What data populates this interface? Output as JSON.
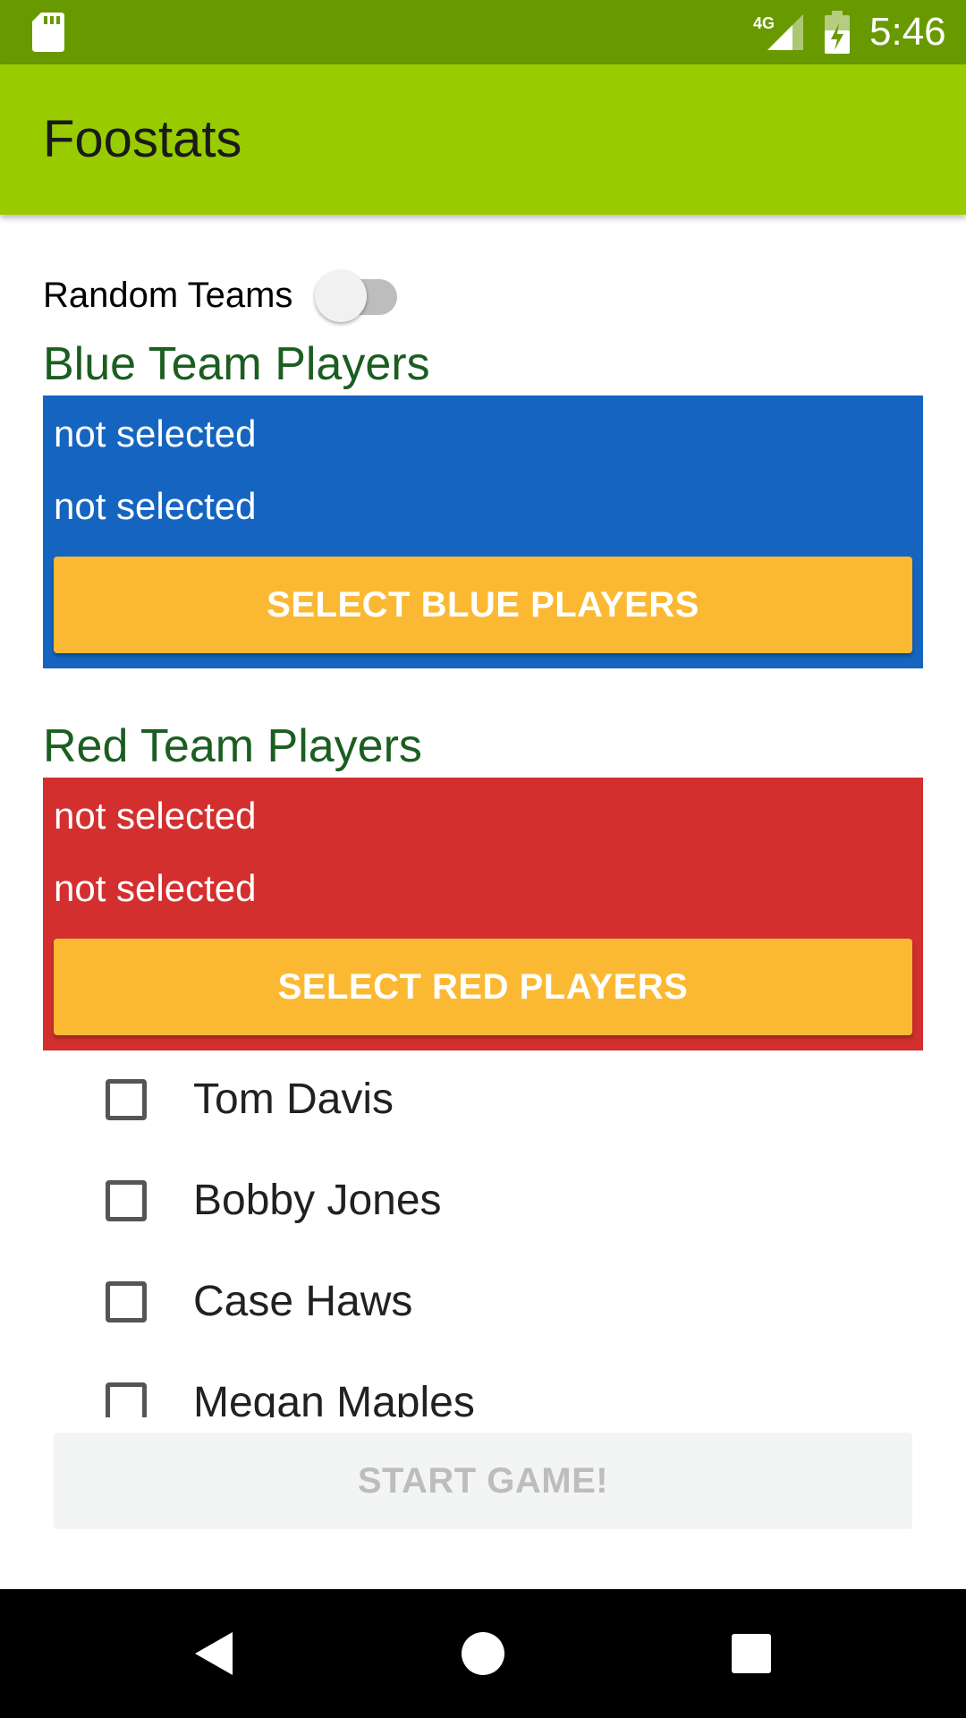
{
  "status_bar": {
    "time": "5:46",
    "network": "4G",
    "icons": [
      "sd-card-icon",
      "signal-icon",
      "battery-icon"
    ],
    "background": "#689a00"
  },
  "app_bar": {
    "title": "Foostats",
    "background": "#99cc00"
  },
  "random_teams": {
    "label": "Random Teams",
    "enabled": false
  },
  "blue_team": {
    "heading": "Blue Team Players",
    "color": "#1565c0",
    "players": [
      "not selected",
      "not selected"
    ],
    "button_label": "SELECT BLUE PLAYERS"
  },
  "red_team": {
    "heading": "Red Team Players",
    "color": "#d32f2f",
    "players": [
      "not selected",
      "not selected"
    ],
    "button_label": "SELECT RED PLAYERS"
  },
  "accent_color": "#fbb933",
  "heading_color": "#1b5e20",
  "player_list": [
    {
      "name": "Tom Davis",
      "checked": false
    },
    {
      "name": "Bobby Jones",
      "checked": false
    },
    {
      "name": "Case Haws",
      "checked": false
    },
    {
      "name": "Megan Maples",
      "checked": false
    }
  ],
  "start_button": {
    "label": "START GAME!",
    "enabled": false
  },
  "nav_bar": {
    "buttons": [
      "back-icon",
      "home-icon",
      "recents-icon"
    ]
  }
}
